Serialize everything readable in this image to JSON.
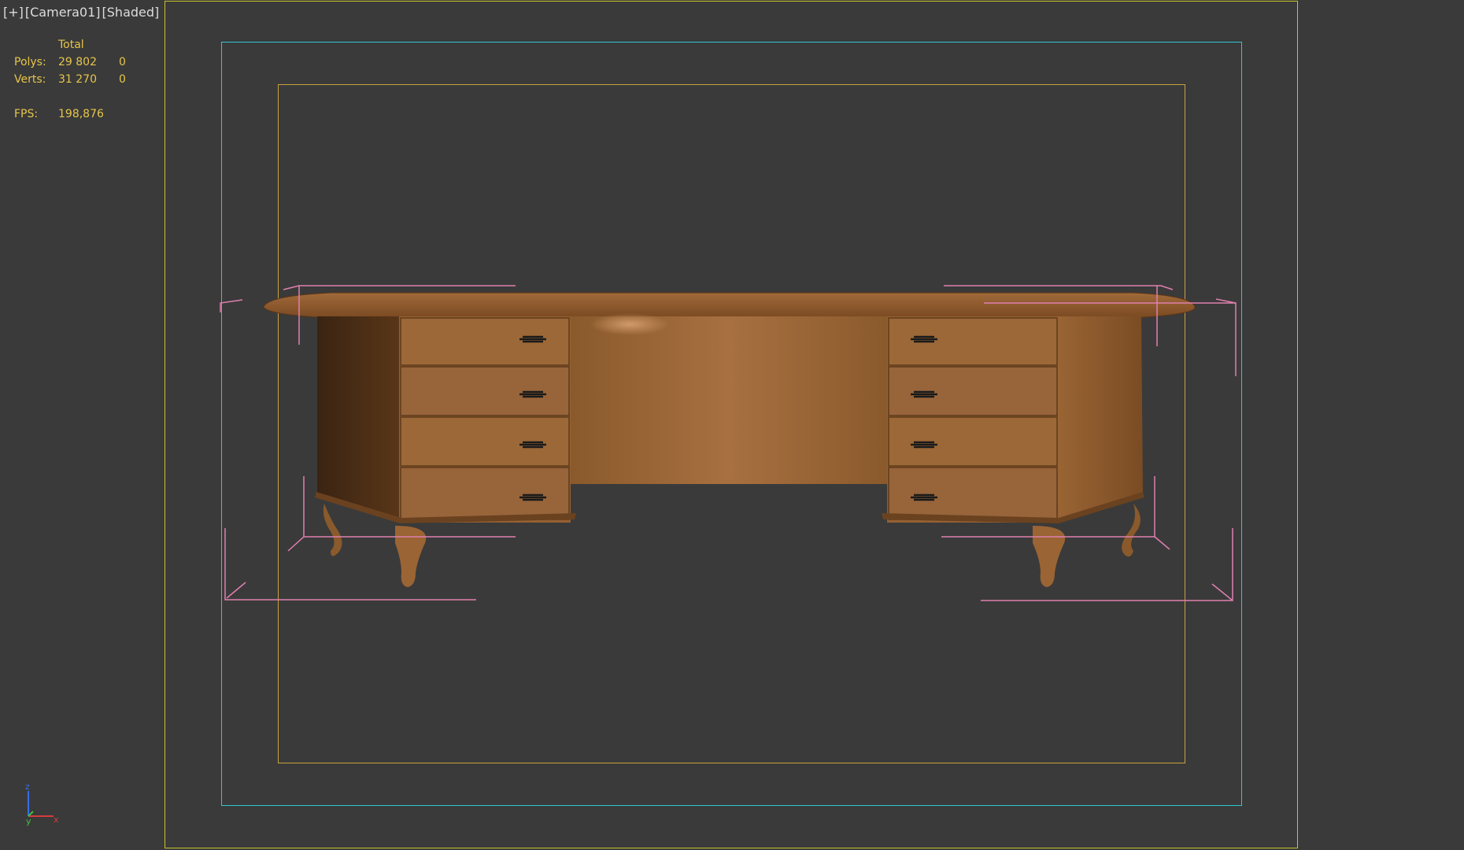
{
  "viewport": {
    "label_plus": "[+]",
    "label_camera": "[Camera01]",
    "label_mode": "[Shaded]"
  },
  "stats": {
    "header": "Total",
    "polys_label": "Polys:",
    "polys_total": "29 802",
    "polys_selected": "0",
    "verts_label": "Verts:",
    "verts_total": "31 270",
    "verts_selected": "0",
    "fps_label": "FPS:",
    "fps_value": "198,876"
  },
  "axis": {
    "z": "z",
    "y": "y",
    "x": "x"
  },
  "colors": {
    "background": "#3a3a3a",
    "safe_frame": "#c9c22d",
    "action_safe": "#2fc8d4",
    "title_safe": "#c9a240",
    "bounding_box": "#e07fae",
    "stats_text": "#e6c54a",
    "wood": "#9a6534"
  },
  "scene": {
    "object": "desk-model"
  }
}
